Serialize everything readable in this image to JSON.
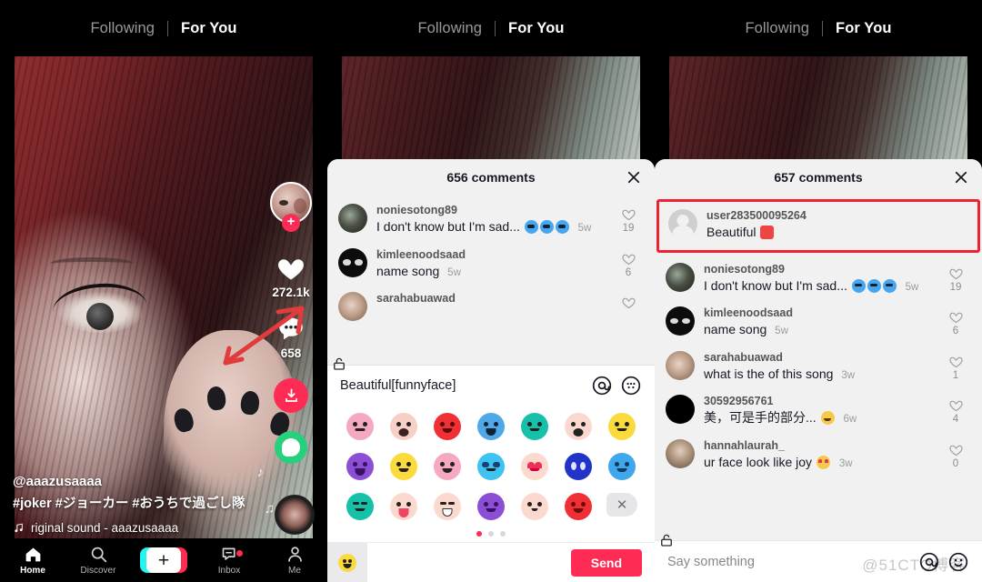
{
  "header": {
    "following_tab": "Following",
    "foryou_tab": "For You"
  },
  "video": {
    "username": "@aaazusaaaa",
    "hashtags": "#joker #ジョーカー  #おうちで過ごし隊",
    "sound": "riginal sound - aaazusaaaa",
    "music_icon": "music-note-icon"
  },
  "actions": {
    "like_count": "272.1k",
    "comment_count": "658",
    "follow_badge": "+",
    "icons": {
      "heart": "heart-icon",
      "comment": "comment-bubble-icon",
      "download": "download-icon",
      "share": "share-icon"
    }
  },
  "bottom_nav": {
    "items": [
      {
        "label": "Home",
        "icon": "home-icon",
        "active": true
      },
      {
        "label": "Discover",
        "icon": "search-icon",
        "active": false
      },
      {
        "label": "",
        "icon": "plus-create-icon",
        "active": false
      },
      {
        "label": "Inbox",
        "icon": "inbox-icon",
        "active": false
      },
      {
        "label": "Me",
        "icon": "person-icon",
        "active": false
      }
    ]
  },
  "sheet_middle": {
    "title": "656 comments",
    "close_icon": "close-icon",
    "comments": [
      {
        "name": "noniesotong89",
        "text": "I don't know but I'm sad...",
        "emojis": "cry-cry-cry",
        "when": "5w",
        "likes": "19",
        "avatar": "a1"
      },
      {
        "name": "kimleenoodsaad",
        "text": "name song",
        "emojis": "",
        "when": "5w",
        "likes": "6",
        "avatar": "a2"
      },
      {
        "name": "sarahabuawad",
        "text": "",
        "emojis": "",
        "when": "",
        "likes": "",
        "avatar": "a3"
      }
    ]
  },
  "keyboard": {
    "input_value": "Beautiful[funnyface]",
    "mention_icon": "at-mention-icon",
    "keyboard_icon": "emoji-keyboard-icon",
    "lock_icon": "unlock-icon",
    "delete_icon": "backspace-icon",
    "send_label": "Send",
    "foot_emoji_icon": "smiley-icon",
    "page_dots": 3,
    "active_dot": 0,
    "rows": [
      [
        {
          "name": "neutral-face-emoji",
          "color": "#f5a8c0"
        },
        {
          "name": "sneeze-face-emoji",
          "color": "#f7cfc4"
        },
        {
          "name": "angry-face-emoji",
          "color": "#ef2f33"
        },
        {
          "name": "crying-face-emoji",
          "color": "#4fa8e8"
        },
        {
          "name": "sweat-face-emoji",
          "color": "#17c0a8"
        },
        {
          "name": "shocked-face-emoji",
          "color": "#fad8d0"
        },
        {
          "name": "dizzy-face-emoji",
          "color": "#fbdb3c"
        }
      ],
      [
        {
          "name": "rage-face-emoji",
          "color": "#8b4fd6"
        },
        {
          "name": "sad-tear-emoji",
          "color": "#fbdb3c"
        },
        {
          "name": "smiling-face-emoji",
          "color": "#f5a8c0"
        },
        {
          "name": "cool-sunglasses-emoji",
          "color": "#3fc3f0"
        },
        {
          "name": "heart-eyes-emoji",
          "color": "#fbd9cf"
        },
        {
          "name": "weary-face-emoji",
          "color": "#2233c8"
        },
        {
          "name": "crying-blue-emoji",
          "color": "#3fa8ec"
        }
      ],
      [
        {
          "name": "smirk-face-emoji",
          "color": "#17c0a8"
        },
        {
          "name": "tongue-out-emoji",
          "color": "#fbd9cf"
        },
        {
          "name": "joy-tears-emoji",
          "color": "#fbd9cf"
        },
        {
          "name": "devil-face-emoji",
          "color": "#8b4fd6"
        },
        {
          "name": "blank-face-emoji",
          "color": "#fbd9cf"
        },
        {
          "name": "furious-face-emoji",
          "color": "#ef2f33"
        }
      ]
    ]
  },
  "sheet_right": {
    "title": "657 comments",
    "close_icon": "close-icon",
    "highlight_color": "#ee2233",
    "new_comment": {
      "name": "user283500095264",
      "text": "Beautiful",
      "emojis": "gift",
      "when": "",
      "likes": "",
      "avatar": "gray"
    },
    "comments": [
      {
        "name": "noniesotong89",
        "text": "I don't know but I'm sad...",
        "emojis": "cry-cry-cry",
        "when": "5w",
        "likes": "19",
        "avatar": "a1"
      },
      {
        "name": "kimleenoodsaad",
        "text": "name song",
        "emojis": "",
        "when": "5w",
        "likes": "6",
        "avatar": "a2"
      },
      {
        "name": "sarahabuawad",
        "text": "what is the of this song",
        "emojis": "",
        "when": "3w",
        "likes": "1",
        "avatar": "a3"
      },
      {
        "name": "30592956761",
        "text": "美，可是手的部分...",
        "emojis": "joy",
        "when": "6w",
        "likes": "4",
        "avatar": "a4"
      },
      {
        "name": "hannahlaurah_",
        "text": "ur face look like joy",
        "emojis": "heart-eye",
        "when": "3w",
        "likes": "0",
        "avatar": "a5"
      }
    ],
    "composer": {
      "placeholder": "Say something",
      "mention_icon": "at-mention-icon",
      "emoji_icon": "smiley-icon",
      "lock_icon": "unlock-icon",
      "watermark": "@51CTO博客"
    }
  },
  "annotation": {
    "arrow": "red-arrow-pointing-to-comment-button",
    "color": "#e23b3b"
  }
}
